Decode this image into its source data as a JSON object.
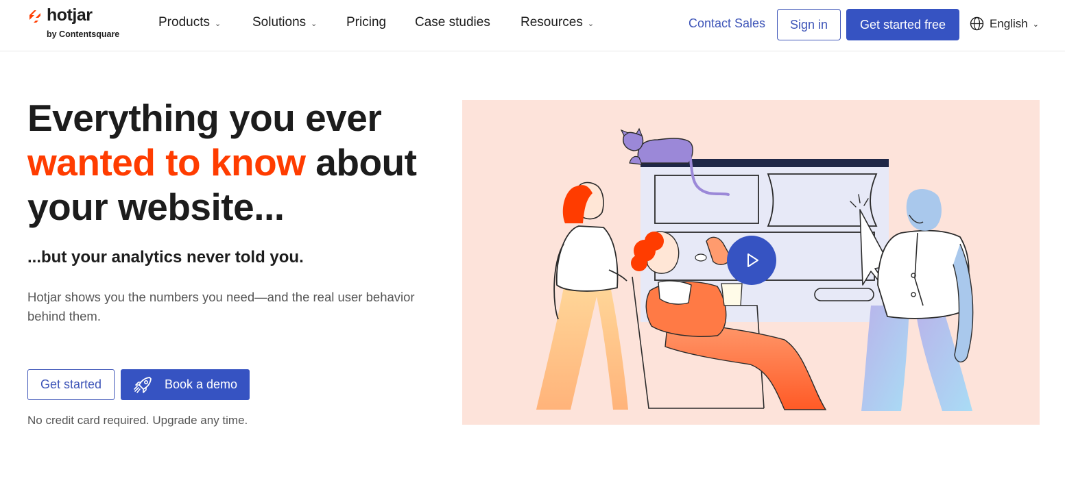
{
  "brand": {
    "name": "hotjar",
    "subtitle": "by Contentsquare",
    "accent_color": "#ff3c00",
    "primary_color": "#3653c2"
  },
  "nav": {
    "items": [
      {
        "label": "Products",
        "has_dropdown": true
      },
      {
        "label": "Solutions",
        "has_dropdown": true
      },
      {
        "label": "Pricing",
        "has_dropdown": false
      },
      {
        "label": "Case studies",
        "has_dropdown": false
      },
      {
        "label": "Resources",
        "has_dropdown": true
      }
    ],
    "contact_sales": "Contact Sales",
    "sign_in": "Sign in",
    "get_started_free": "Get started free",
    "language": "English",
    "language_icon": "globe-icon"
  },
  "hero": {
    "headline_part1": "Everything you ever",
    "headline_accent": "wanted to know",
    "headline_part2": "about your website...",
    "subheadline": "...but your analytics never told you.",
    "description": "Hotjar shows you the numbers you need—and the real user behavior behind them.",
    "cta_primary": "Get started",
    "cta_demo": "Book a demo",
    "cta_demo_icon": "rocket-icon",
    "fineprint": "No credit card required. Upgrade any time."
  },
  "illustration": {
    "play_icon": "play-icon",
    "background_color": "#fde3da"
  }
}
